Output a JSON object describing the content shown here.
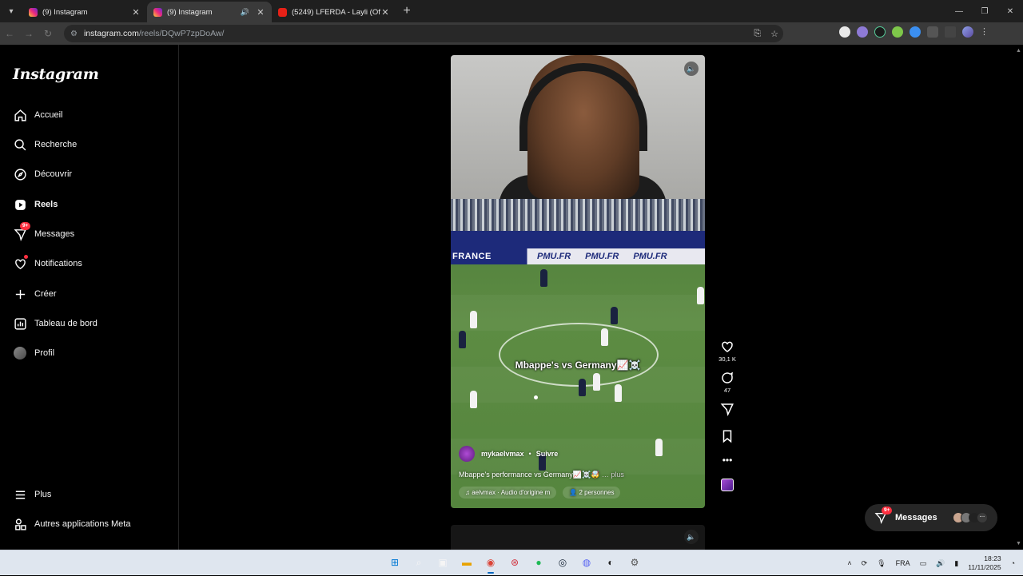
{
  "browser": {
    "tabs": [
      {
        "title": "(9) Instagram",
        "favicon": "instagram-icon",
        "active": false
      },
      {
        "title": "(9) Instagram",
        "favicon": "instagram-icon",
        "active": true
      },
      {
        "title": "(5249) LFERDA - Layli (Official A",
        "favicon": "youtube-icon",
        "active": false
      }
    ],
    "url_host": "instagram.com",
    "url_path": "/reels/DQwP7zpDoAw/"
  },
  "sidebar": {
    "logo": "Instagram",
    "items": [
      {
        "label": "Accueil",
        "icon": "home-icon"
      },
      {
        "label": "Recherche",
        "icon": "search-icon"
      },
      {
        "label": "Découvrir",
        "icon": "compass-icon"
      },
      {
        "label": "Reels",
        "icon": "reels-icon"
      },
      {
        "label": "Messages",
        "icon": "messenger-icon",
        "badge": "9+"
      },
      {
        "label": "Notifications",
        "icon": "heart-icon"
      },
      {
        "label": "Créer",
        "icon": "plus-icon"
      },
      {
        "label": "Tableau de bord",
        "icon": "dashboard-icon"
      },
      {
        "label": "Profil",
        "icon": "avatar"
      }
    ],
    "bottom": [
      {
        "label": "Plus",
        "icon": "menu-icon"
      },
      {
        "label": "Autres applications Meta",
        "icon": "meta-apps-icon"
      }
    ]
  },
  "reel": {
    "board_text": "FRANCE",
    "sponsor": "PMU.FR",
    "overlay": "Mbappe's  vs Germany📈☠️",
    "username": "mykaelvmax",
    "separator": "•",
    "follow": "Suivre",
    "caption": "Mbappe's performance vs Germany📈☠️🤯",
    "caption_more": "… plus",
    "audio": "aelvmax · Audio d'origine   m",
    "people": "2 personnes"
  },
  "actions": {
    "likes": "30,1 K",
    "comments": "47"
  },
  "messages_pill": {
    "label": "Messages",
    "badge": "9+"
  },
  "taskbar": {
    "lang": "FRA",
    "time": "18:23",
    "date": "11/11/2025"
  }
}
